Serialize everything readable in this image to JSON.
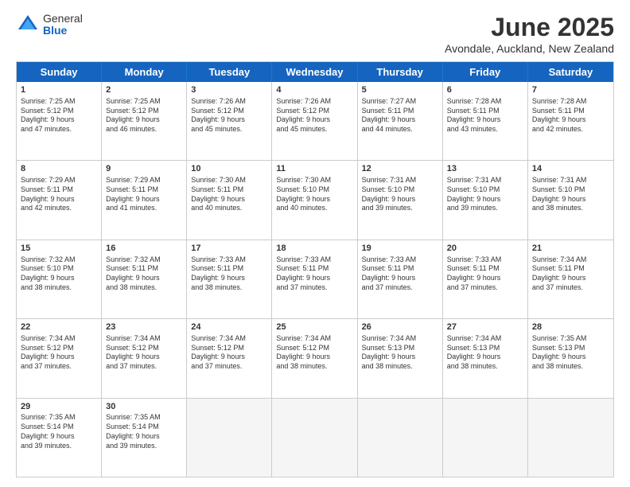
{
  "logo": {
    "general": "General",
    "blue": "Blue"
  },
  "title": "June 2025",
  "subtitle": "Avondale, Auckland, New Zealand",
  "days": [
    "Sunday",
    "Monday",
    "Tuesday",
    "Wednesday",
    "Thursday",
    "Friday",
    "Saturday"
  ],
  "rows": [
    [
      {
        "day": "1",
        "info": "Sunrise: 7:25 AM\nSunset: 5:12 PM\nDaylight: 9 hours\nand 47 minutes."
      },
      {
        "day": "2",
        "info": "Sunrise: 7:25 AM\nSunset: 5:12 PM\nDaylight: 9 hours\nand 46 minutes."
      },
      {
        "day": "3",
        "info": "Sunrise: 7:26 AM\nSunset: 5:12 PM\nDaylight: 9 hours\nand 45 minutes."
      },
      {
        "day": "4",
        "info": "Sunrise: 7:26 AM\nSunset: 5:12 PM\nDaylight: 9 hours\nand 45 minutes."
      },
      {
        "day": "5",
        "info": "Sunrise: 7:27 AM\nSunset: 5:11 PM\nDaylight: 9 hours\nand 44 minutes."
      },
      {
        "day": "6",
        "info": "Sunrise: 7:28 AM\nSunset: 5:11 PM\nDaylight: 9 hours\nand 43 minutes."
      },
      {
        "day": "7",
        "info": "Sunrise: 7:28 AM\nSunset: 5:11 PM\nDaylight: 9 hours\nand 42 minutes."
      }
    ],
    [
      {
        "day": "8",
        "info": "Sunrise: 7:29 AM\nSunset: 5:11 PM\nDaylight: 9 hours\nand 42 minutes."
      },
      {
        "day": "9",
        "info": "Sunrise: 7:29 AM\nSunset: 5:11 PM\nDaylight: 9 hours\nand 41 minutes."
      },
      {
        "day": "10",
        "info": "Sunrise: 7:30 AM\nSunset: 5:11 PM\nDaylight: 9 hours\nand 40 minutes."
      },
      {
        "day": "11",
        "info": "Sunrise: 7:30 AM\nSunset: 5:10 PM\nDaylight: 9 hours\nand 40 minutes."
      },
      {
        "day": "12",
        "info": "Sunrise: 7:31 AM\nSunset: 5:10 PM\nDaylight: 9 hours\nand 39 minutes."
      },
      {
        "day": "13",
        "info": "Sunrise: 7:31 AM\nSunset: 5:10 PM\nDaylight: 9 hours\nand 39 minutes."
      },
      {
        "day": "14",
        "info": "Sunrise: 7:31 AM\nSunset: 5:10 PM\nDaylight: 9 hours\nand 38 minutes."
      }
    ],
    [
      {
        "day": "15",
        "info": "Sunrise: 7:32 AM\nSunset: 5:10 PM\nDaylight: 9 hours\nand 38 minutes."
      },
      {
        "day": "16",
        "info": "Sunrise: 7:32 AM\nSunset: 5:11 PM\nDaylight: 9 hours\nand 38 minutes."
      },
      {
        "day": "17",
        "info": "Sunrise: 7:33 AM\nSunset: 5:11 PM\nDaylight: 9 hours\nand 38 minutes."
      },
      {
        "day": "18",
        "info": "Sunrise: 7:33 AM\nSunset: 5:11 PM\nDaylight: 9 hours\nand 37 minutes."
      },
      {
        "day": "19",
        "info": "Sunrise: 7:33 AM\nSunset: 5:11 PM\nDaylight: 9 hours\nand 37 minutes."
      },
      {
        "day": "20",
        "info": "Sunrise: 7:33 AM\nSunset: 5:11 PM\nDaylight: 9 hours\nand 37 minutes."
      },
      {
        "day": "21",
        "info": "Sunrise: 7:34 AM\nSunset: 5:11 PM\nDaylight: 9 hours\nand 37 minutes."
      }
    ],
    [
      {
        "day": "22",
        "info": "Sunrise: 7:34 AM\nSunset: 5:12 PM\nDaylight: 9 hours\nand 37 minutes."
      },
      {
        "day": "23",
        "info": "Sunrise: 7:34 AM\nSunset: 5:12 PM\nDaylight: 9 hours\nand 37 minutes."
      },
      {
        "day": "24",
        "info": "Sunrise: 7:34 AM\nSunset: 5:12 PM\nDaylight: 9 hours\nand 37 minutes."
      },
      {
        "day": "25",
        "info": "Sunrise: 7:34 AM\nSunset: 5:12 PM\nDaylight: 9 hours\nand 38 minutes."
      },
      {
        "day": "26",
        "info": "Sunrise: 7:34 AM\nSunset: 5:13 PM\nDaylight: 9 hours\nand 38 minutes."
      },
      {
        "day": "27",
        "info": "Sunrise: 7:34 AM\nSunset: 5:13 PM\nDaylight: 9 hours\nand 38 minutes."
      },
      {
        "day": "28",
        "info": "Sunrise: 7:35 AM\nSunset: 5:13 PM\nDaylight: 9 hours\nand 38 minutes."
      }
    ],
    [
      {
        "day": "29",
        "info": "Sunrise: 7:35 AM\nSunset: 5:14 PM\nDaylight: 9 hours\nand 39 minutes."
      },
      {
        "day": "30",
        "info": "Sunrise: 7:35 AM\nSunset: 5:14 PM\nDaylight: 9 hours\nand 39 minutes."
      },
      {
        "day": "",
        "info": ""
      },
      {
        "day": "",
        "info": ""
      },
      {
        "day": "",
        "info": ""
      },
      {
        "day": "",
        "info": ""
      },
      {
        "day": "",
        "info": ""
      }
    ]
  ]
}
